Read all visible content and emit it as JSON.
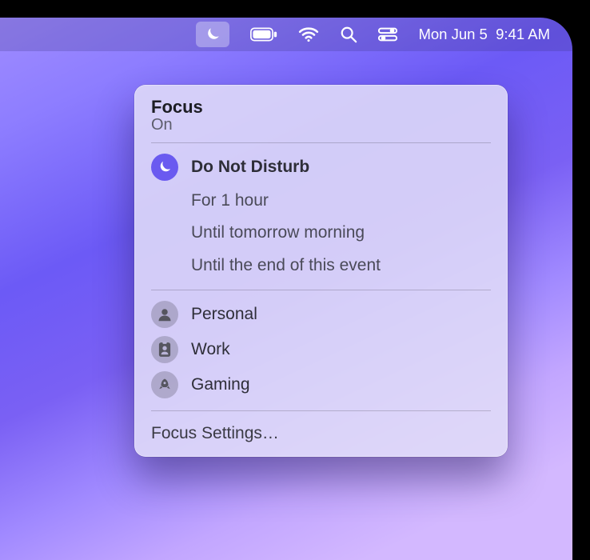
{
  "menubar": {
    "clock": "Mon Jun 5  9:41 AM"
  },
  "panel": {
    "title": "Focus",
    "status": "On",
    "dnd_label": "Do Not Disturb",
    "dnd_options": [
      "For 1 hour",
      "Until tomorrow morning",
      "Until the end of this event"
    ],
    "modes": [
      {
        "label": "Personal"
      },
      {
        "label": "Work"
      },
      {
        "label": "Gaming"
      }
    ],
    "settings_label": "Focus Settings…"
  }
}
